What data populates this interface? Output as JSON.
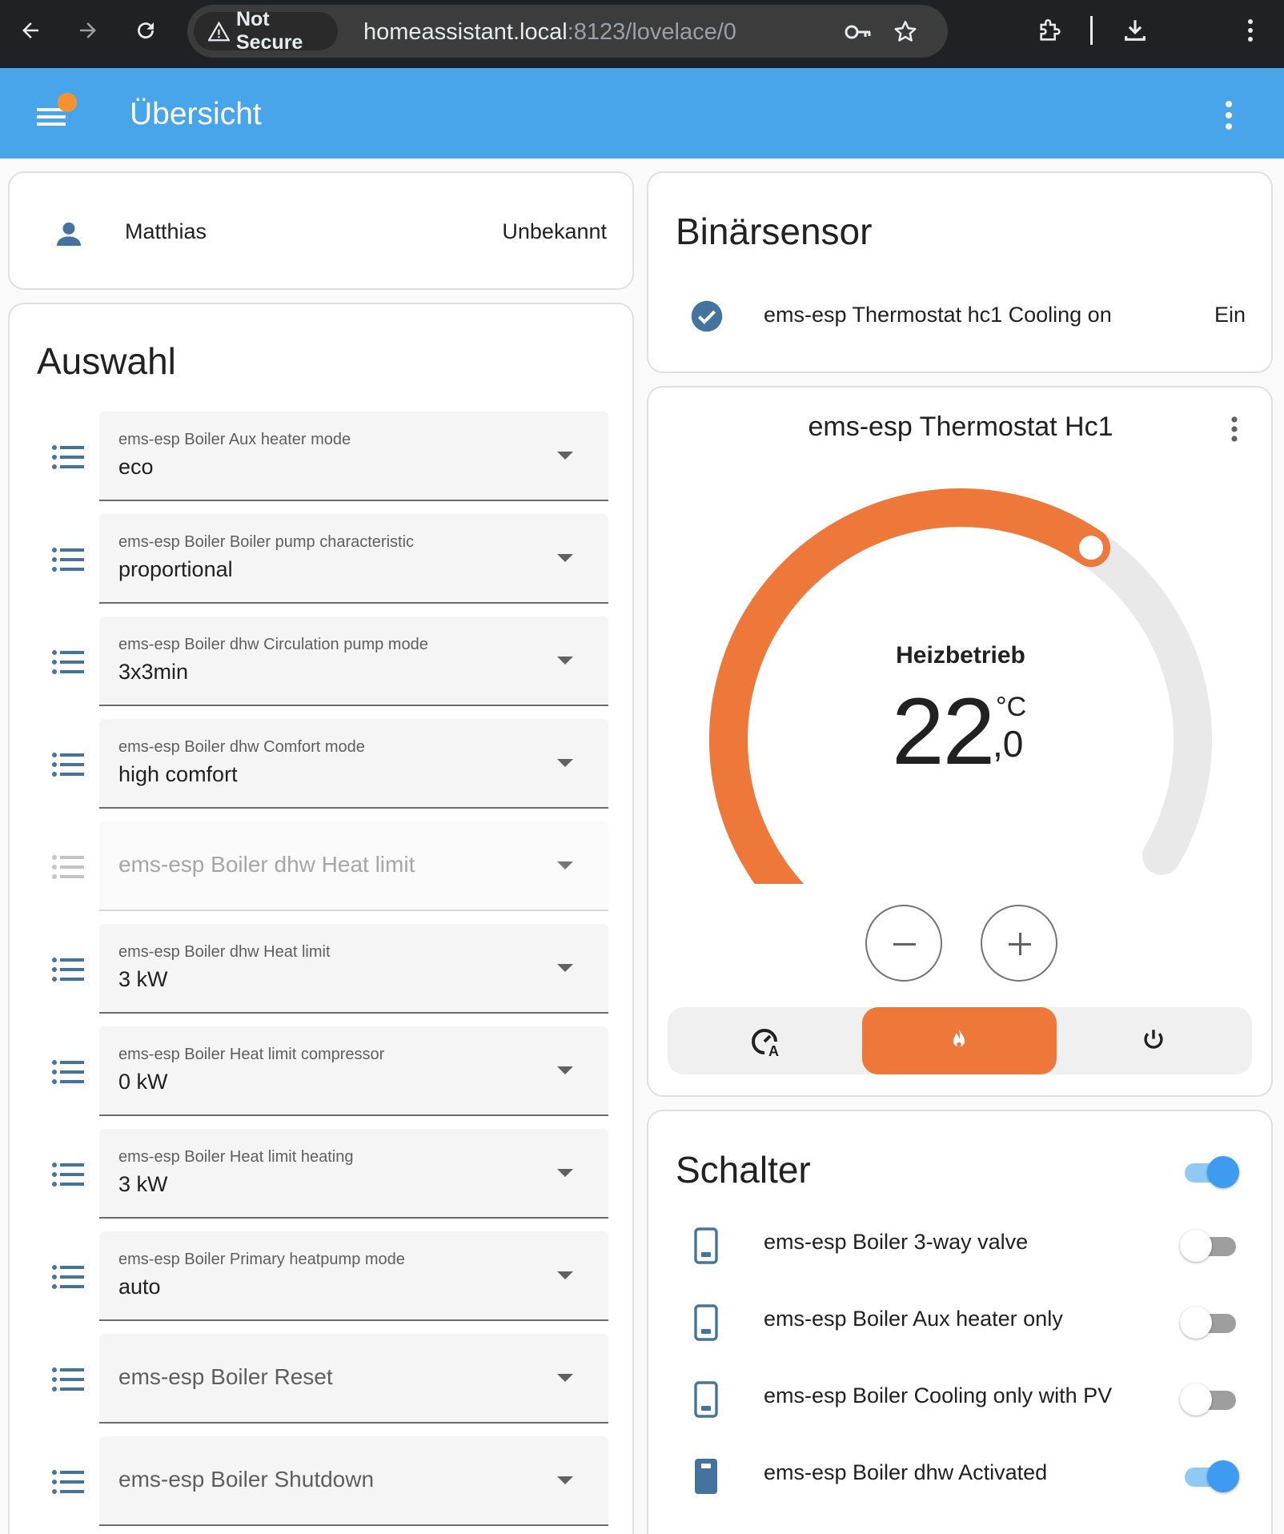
{
  "browser": {
    "security_label": "Not Secure",
    "url_host": "homeassistant.local",
    "url_rest": ":8123/lovelace/0"
  },
  "header": {
    "title": "Übersicht"
  },
  "person": {
    "name": "Matthias",
    "state": "Unbekannt"
  },
  "auswahl": {
    "title": "Auswahl",
    "rows": [
      {
        "label": "ems-esp Boiler Aux heater mode",
        "value": "eco"
      },
      {
        "label": "ems-esp Boiler Boiler pump characteristic",
        "value": "proportional"
      },
      {
        "label": "ems-esp Boiler dhw Circulation pump mode",
        "value": "3x3min"
      },
      {
        "label": "ems-esp Boiler dhw Comfort mode",
        "value": "high comfort"
      },
      {
        "single": "ems-esp Boiler dhw Heat limit",
        "disabled": true
      },
      {
        "label": "ems-esp Boiler dhw Heat limit",
        "value": "3 kW"
      },
      {
        "label": "ems-esp Boiler Heat limit compressor",
        "value": "0 kW"
      },
      {
        "label": "ems-esp Boiler Heat limit heating",
        "value": "3 kW"
      },
      {
        "label": "ems-esp Boiler Primary heatpump mode",
        "value": "auto"
      },
      {
        "single": "ems-esp Boiler Reset"
      },
      {
        "single": "ems-esp Boiler Shutdown"
      }
    ]
  },
  "binary": {
    "title": "Binärsensor",
    "entity_name": "ems-esp Thermostat hc1 Cooling on",
    "entity_state": "Ein"
  },
  "thermostat": {
    "title": "ems-esp Thermostat Hc1",
    "mode_label": "Heizbetrieb",
    "temp_int": "22",
    "temp_unit": "°C",
    "temp_dec": ",0",
    "setpoint_fraction": 0.67,
    "colors": {
      "arc": "#ee773a",
      "track": "#e9e9e9"
    },
    "modes": [
      "auto-mode-icon",
      "heat-flame-icon",
      "power-icon"
    ],
    "active_mode": "heat"
  },
  "schalter": {
    "title": "Schalter",
    "master_on": true,
    "items": [
      {
        "name": "ems-esp Boiler 3-way valve",
        "on": false
      },
      {
        "name": "ems-esp Boiler Aux heater only",
        "on": false
      },
      {
        "name": "ems-esp Boiler Cooling only with PV",
        "on": false
      },
      {
        "name": "ems-esp Boiler dhw Activated",
        "on": true
      }
    ]
  },
  "colors": {
    "header": "#49a5ea",
    "accent_orange": "#ee773a",
    "icon_blue": "#44739e",
    "toggle_on": "#3d9cf0"
  }
}
